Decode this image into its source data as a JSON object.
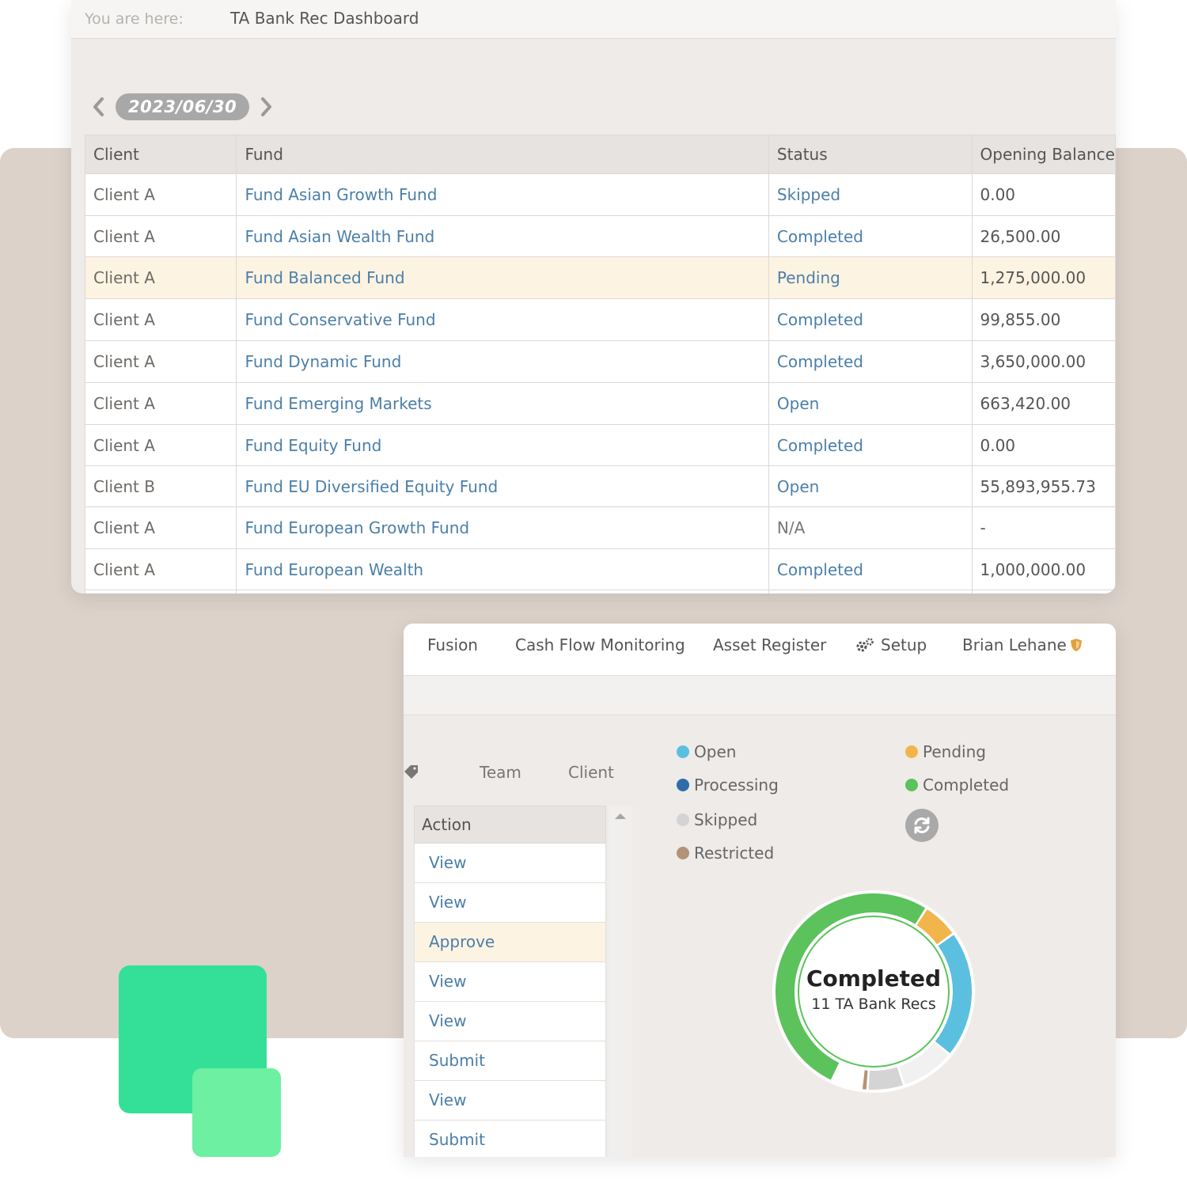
{
  "breadcrumb": {
    "prefix": "You are here:",
    "current": "TA Bank Rec Dashboard"
  },
  "date_nav": {
    "date": "2023/06/30",
    "prev_icon": "chevron-left-icon",
    "next_icon": "chevron-right-icon"
  },
  "fund_table": {
    "columns": [
      "Client",
      "Fund",
      "Status",
      "Opening Balance"
    ],
    "rows": [
      {
        "client": "Client A",
        "fund": "Fund Asian Growth Fund",
        "status": "Skipped",
        "opening_balance": "0.00"
      },
      {
        "client": "Client A",
        "fund": "Fund Asian Wealth Fund",
        "status": "Completed",
        "opening_balance": "26,500.00"
      },
      {
        "client": "Client A",
        "fund": "Fund Balanced Fund",
        "status": "Pending",
        "opening_balance": "1,275,000.00"
      },
      {
        "client": "Client A",
        "fund": "Fund Conservative Fund",
        "status": "Completed",
        "opening_balance": "99,855.00"
      },
      {
        "client": "Client A",
        "fund": "Fund Dynamic Fund",
        "status": "Completed",
        "opening_balance": "3,650,000.00"
      },
      {
        "client": "Client A",
        "fund": "Fund Emerging Markets",
        "status": "Open",
        "opening_balance": "663,420.00"
      },
      {
        "client": "Client A",
        "fund": "Fund Equity Fund",
        "status": "Completed",
        "opening_balance": "0.00"
      },
      {
        "client": "Client B",
        "fund": "Fund EU Diversified Equity Fund",
        "status": "Open",
        "opening_balance": "55,893,955.73"
      },
      {
        "client": "Client A",
        "fund": "Fund European Growth Fund",
        "status": "N/A",
        "opening_balance": "-"
      },
      {
        "client": "Client A",
        "fund": "Fund European Wealth",
        "status": "Completed",
        "opening_balance": "1,000,000.00"
      }
    ]
  },
  "topnav": {
    "items": [
      "Fusion",
      "Cash Flow Monitoring",
      "Asset Register",
      "Setup",
      "Brian Lehane"
    ],
    "setup_icon": "gears-icon",
    "user_icon": "shield-icon"
  },
  "columns": {
    "team": "Team",
    "client": "Client",
    "tag_icon": "tag-icon"
  },
  "action_list": {
    "header": "Action",
    "items": [
      "View",
      "View",
      "Approve",
      "View",
      "View",
      "Submit",
      "View",
      "Submit"
    ]
  },
  "legend": [
    {
      "label": "Open",
      "color": "#5bbfe0"
    },
    {
      "label": "Pending",
      "color": "#f2b54c"
    },
    {
      "label": "Processing",
      "color": "#2f6da8"
    },
    {
      "label": "Completed",
      "color": "#5cc25c"
    },
    {
      "label": "Skipped",
      "color": "#d4d4d4"
    },
    {
      "label": "Restricted",
      "color": "#b39378"
    }
  ],
  "refresh_icon": "refresh-icon",
  "donut": {
    "title": "Completed",
    "subtitle": "11 TA Bank Recs",
    "segments": [
      {
        "status": "Completed",
        "share": 0.52,
        "color": "#5cc25c"
      },
      {
        "status": "Pending",
        "share": 0.06,
        "color": "#f2b54c"
      },
      {
        "status": "Open",
        "share": 0.21,
        "color": "#5bbfe0"
      },
      {
        "status": "N/A",
        "share": 0.09,
        "color": "#f1f1f1"
      },
      {
        "status": "Skipped",
        "share": 0.06,
        "color": "#d4d4d4"
      },
      {
        "status": "Restricted",
        "share": 0.01,
        "color": "#b39378"
      }
    ]
  }
}
